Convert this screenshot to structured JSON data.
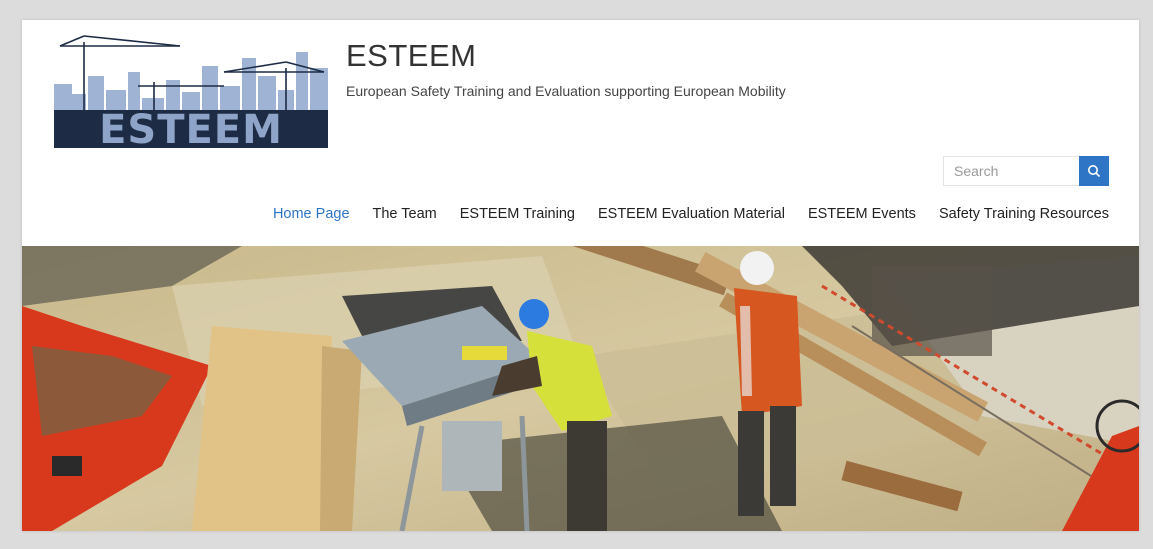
{
  "header": {
    "logo_text": "ESTEEM",
    "title": "ESTEEM",
    "tagline": "European Safety Training and Evaluation supporting European Mobility"
  },
  "search": {
    "placeholder": "Search",
    "value": "",
    "button_icon": "search-icon"
  },
  "nav": {
    "items": [
      {
        "label": "Home Page",
        "active": true
      },
      {
        "label": "The Team",
        "active": false
      },
      {
        "label": "ESTEEM Training",
        "active": false
      },
      {
        "label": "ESTEEM Evaluation Material",
        "active": false
      },
      {
        "label": "ESTEEM Events",
        "active": false
      },
      {
        "label": "Safety Training Resources",
        "active": false
      }
    ]
  },
  "hero": {
    "image": "construction-workers-photo"
  },
  "colors": {
    "accent": "#2f75c5",
    "text": "#222222",
    "logo_navy": "#1d2b45",
    "logo_blue": "#8ea4c8"
  }
}
